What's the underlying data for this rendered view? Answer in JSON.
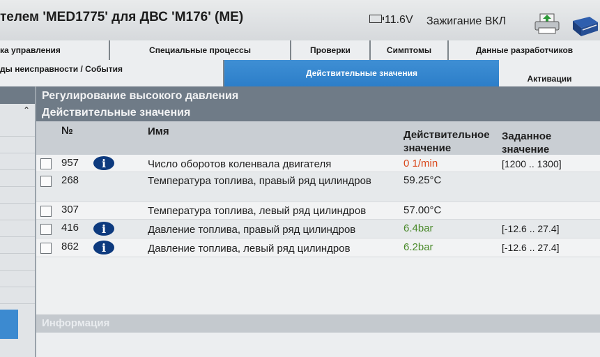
{
  "header": {
    "title": "телем 'MED1775' для ДВС 'M176' (ME)",
    "voltage": "11.6V",
    "ignition": "Зажигание ВКЛ"
  },
  "icons": {
    "battery": "battery-icon",
    "printer": "printer-icon",
    "book": "book-icon",
    "info": "info-icon"
  },
  "tabs_row1": [
    {
      "label": "ка управления"
    },
    {
      "label": "Специальные процессы"
    },
    {
      "label": "Проверки"
    },
    {
      "label": "Симптомы"
    },
    {
      "label": "Данные разработчиков"
    }
  ],
  "tabs_row2": [
    {
      "label": "ды неисправности / События"
    },
    {
      "label": "Действительные значения",
      "active": true
    },
    {
      "label": "Активации"
    }
  ],
  "group": {
    "title": "Регулирование высокого давления",
    "subtitle": "Действительные значения"
  },
  "table": {
    "headers": {
      "num": "№",
      "name": "Имя",
      "actual_line1": "Действительное",
      "actual_line2": "значение",
      "set_line1": "Заданное",
      "set_line2": "значение"
    },
    "rows": [
      {
        "num": "957",
        "info": true,
        "name": "Число оборотов коленвала двигателя",
        "value": "0 1/min",
        "value_color": "#d9471a",
        "setpoint": "[1200 .. 1300]"
      },
      {
        "num": "268",
        "info": false,
        "name": "Температура топлива, правый ряд цилиндров",
        "value": "59.25°C",
        "value_color": "#1e1e1e",
        "setpoint": ""
      },
      {
        "num": "307",
        "info": false,
        "name": "Температура топлива, левый ряд цилиндров",
        "value": "57.00°C",
        "value_color": "#1e1e1e",
        "setpoint": ""
      },
      {
        "num": "416",
        "info": true,
        "name": "Давление топлива, правый ряд цилиндров",
        "value": "6.4bar",
        "value_color": "#4a8a2a",
        "setpoint": "[-12.6 .. 27.4]"
      },
      {
        "num": "862",
        "info": true,
        "name": "Давление топлива, левый ряд цилиндров",
        "value": "6.2bar",
        "value_color": "#4a8a2a",
        "setpoint": "[-12.6 .. 27.4]"
      }
    ]
  },
  "info_section": {
    "label": "Информация"
  },
  "colors": {
    "accent_tab": "#2c7ec9",
    "group_header": "#6f7b87",
    "info_icon": "#0d3a7e"
  }
}
